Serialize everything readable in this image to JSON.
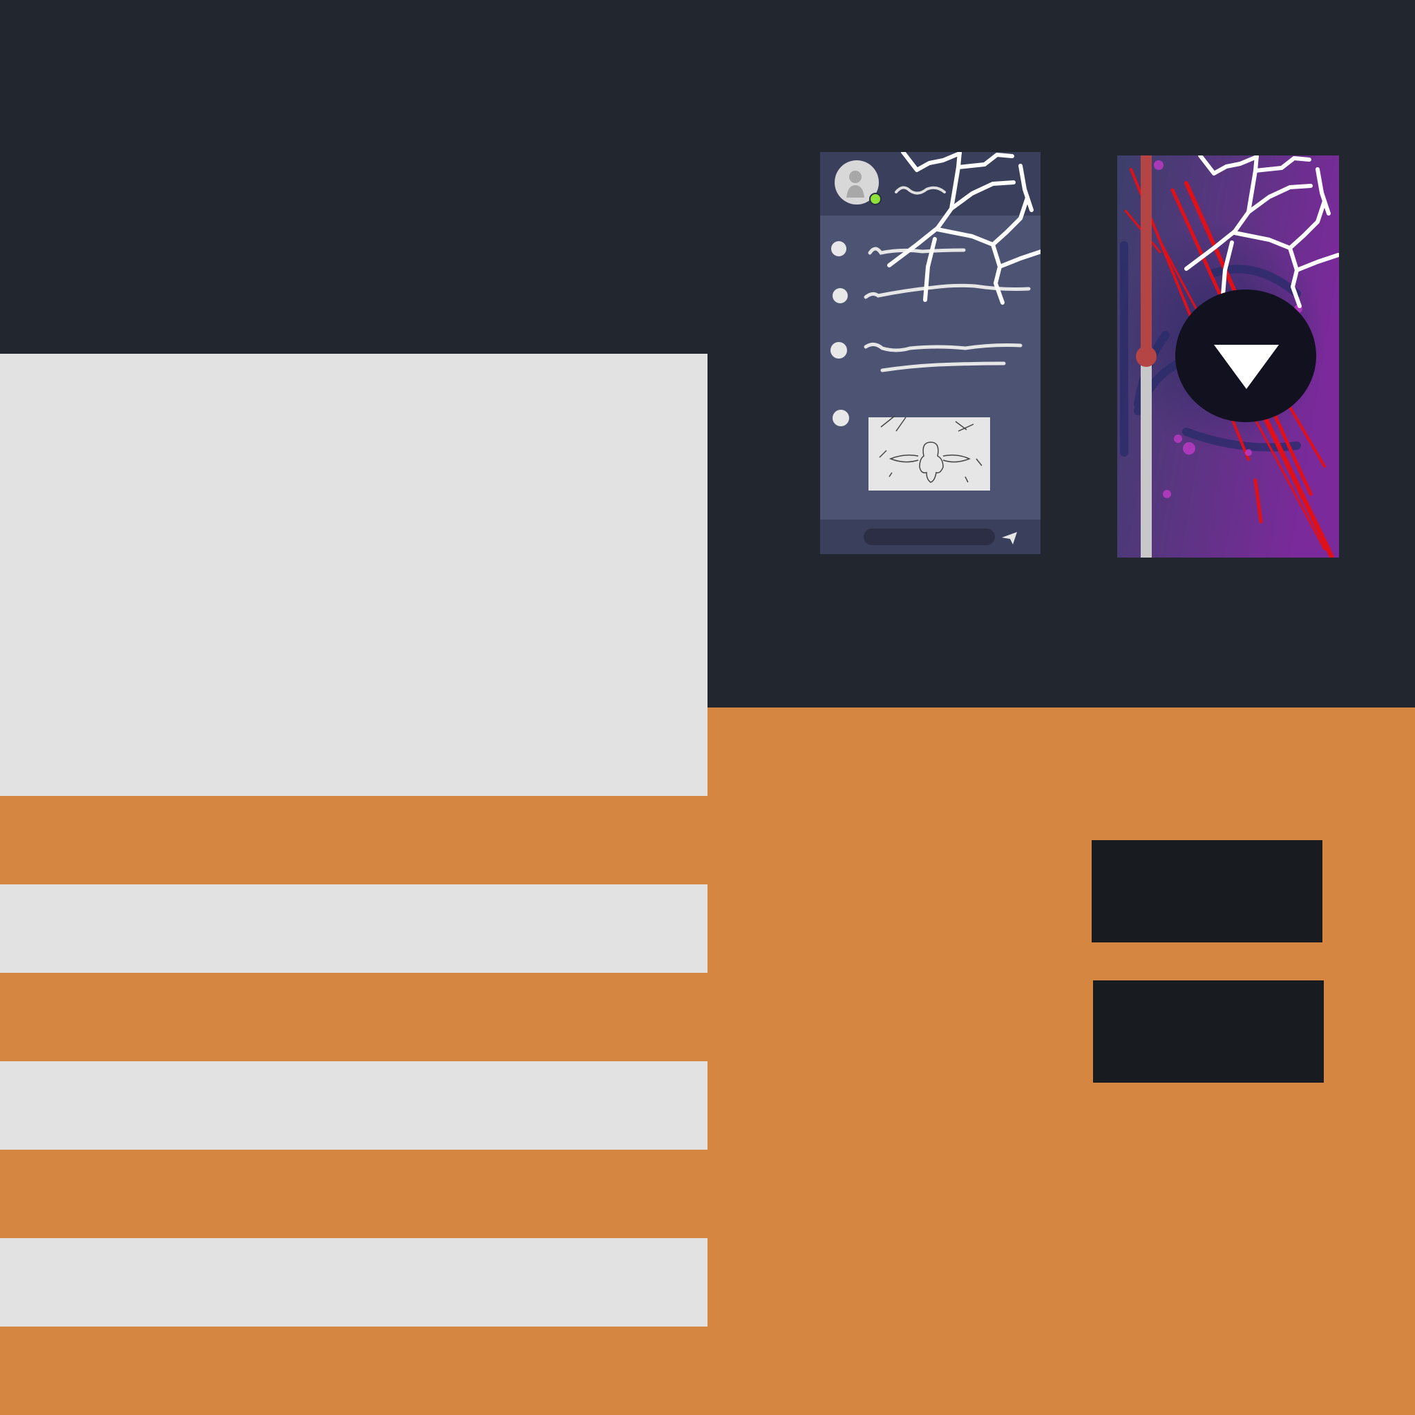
{
  "colors": {
    "top_band": "#22262f",
    "orange": "#d58640",
    "light_block": "#e2e2e2",
    "dark_button": "#181c20",
    "chat_bg": "#4d5373",
    "chat_header": "#3a3f5c",
    "chat_input_bar": "#3a3f5c",
    "online_dot": "#8ee23a",
    "game_purple": "#7a2a9a",
    "game_dark": "#3c3f6a",
    "play_circle": "#12111f",
    "progress_red": "#b54545",
    "crack_white": "#ffffff"
  },
  "icons": {
    "avatar": "avatar-icon",
    "send": "send-icon",
    "play": "play-triangle-icon",
    "crack": "crack-overlay"
  },
  "game": {
    "progress_fraction": 0.5
  }
}
